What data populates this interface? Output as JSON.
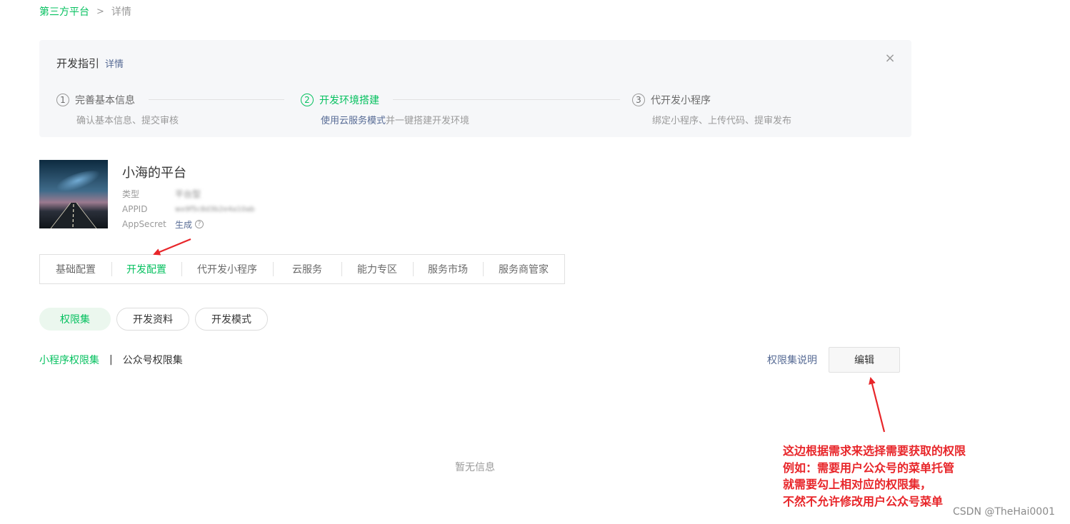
{
  "breadcrumb": {
    "root": "第三方平台",
    "separator": ">",
    "current": "详情"
  },
  "guide": {
    "title": "开发指引",
    "detail_link": "详情",
    "close_icon": "close-icon",
    "steps": [
      {
        "num": "1",
        "title": "完善基本信息",
        "desc": "确认基本信息、提交审核",
        "active": false
      },
      {
        "num": "2",
        "title": "开发环境搭建",
        "desc_highlight": "使用云服务模式",
        "desc": "并一键搭建开发环境",
        "active": true
      },
      {
        "num": "3",
        "title": "代开发小程序",
        "desc": "绑定小程序、上传代码、提审发布",
        "active": false
      }
    ]
  },
  "account": {
    "name": "小海的平台",
    "type_label": "类型",
    "type_value": "平台型",
    "appid_label": "APPID",
    "appid_value": "wx9f5c8d3b2e4a10ab",
    "secret_label": "AppSecret",
    "secret_link": "生成",
    "help_icon": "question-icon"
  },
  "tabs": [
    "基础配置",
    "开发配置",
    "代开发小程序",
    "云服务",
    "能力专区",
    "服务市场",
    "服务商管家"
  ],
  "active_tab": "开发配置",
  "subtabs": [
    "权限集",
    "开发资料",
    "开发模式"
  ],
  "active_subtab": "权限集",
  "permission": {
    "tab_miniprogram": "小程序权限集",
    "separator": "|",
    "tab_official": "公众号权限集",
    "explain_link": "权限集说明",
    "edit_button": "编辑",
    "empty_text": "暂无信息"
  },
  "annotation": {
    "lines": [
      "这边根据需求来选择需要获取的权限",
      "例如：需要用户公众号的菜单托管",
      "就需要勾上相对应的权限集，",
      "不然不允许修改用户公众号菜单"
    ],
    "color": "#e8262a"
  },
  "watermark": "CSDN @TheHai0001",
  "colors": {
    "brand_green": "#07c160",
    "link_blue": "#576b95",
    "annotation_red": "#e8262a"
  }
}
